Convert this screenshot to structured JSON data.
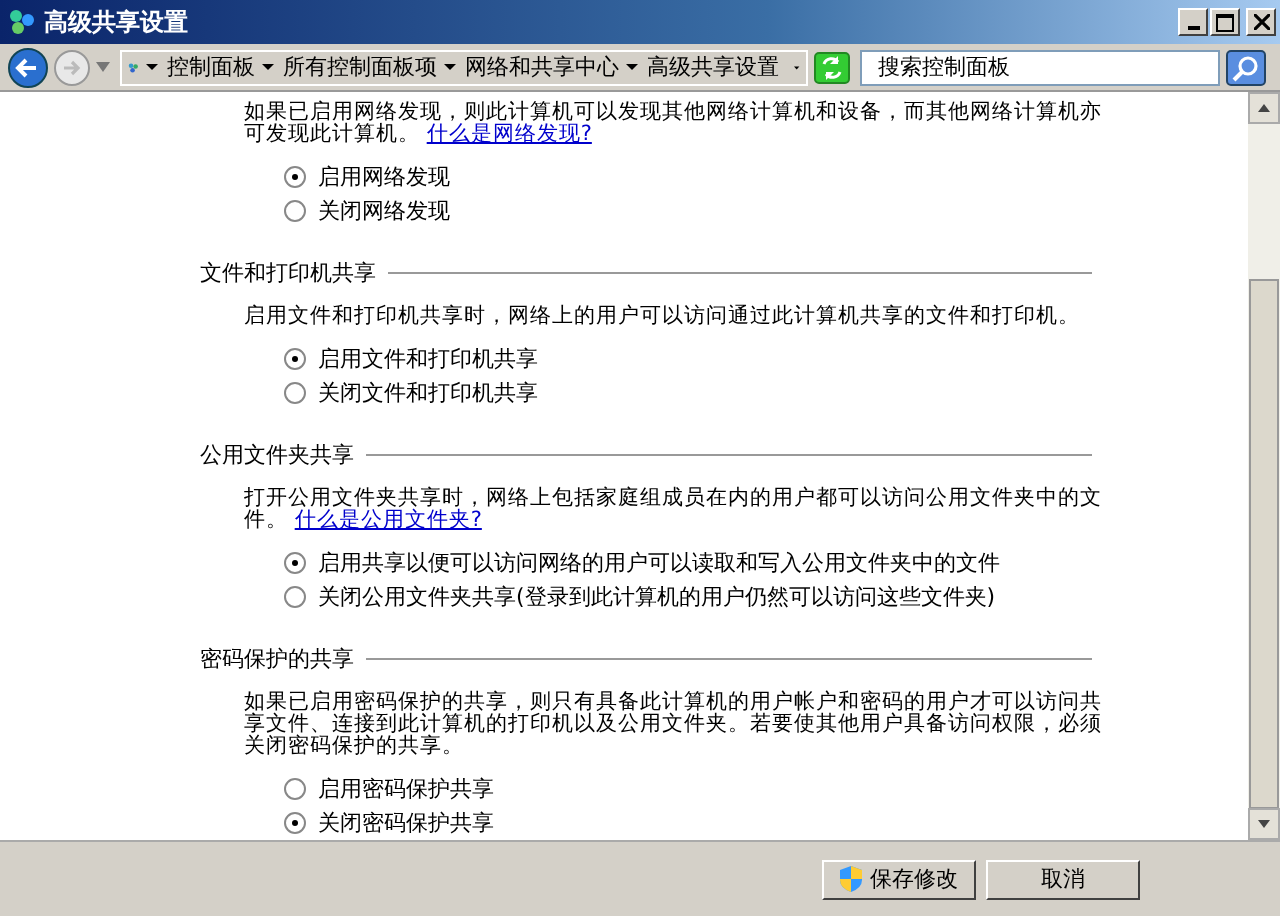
{
  "window": {
    "title": "高级共享设置"
  },
  "address_bar": {
    "breadcrumbs": [
      "控制面板",
      "所有控制面板项",
      "网络和共享中心",
      "高级共享设置"
    ]
  },
  "search": {
    "placeholder": "搜索控制面板"
  },
  "sections": [
    {
      "description": "如果已启用网络发现，则此计算机可以发现其他网络计算机和设备，而其他网络计算机亦可发现此计算机。",
      "link": "什么是网络发现?",
      "options": [
        {
          "label": "启用网络发现",
          "selected": true
        },
        {
          "label": "关闭网络发现",
          "selected": false
        }
      ]
    },
    {
      "heading": "文件和打印机共享",
      "description": "启用文件和打印机共享时，网络上的用户可以访问通过此计算机共享的文件和打印机。",
      "options": [
        {
          "label": "启用文件和打印机共享",
          "selected": true
        },
        {
          "label": "关闭文件和打印机共享",
          "selected": false
        }
      ]
    },
    {
      "heading": "公用文件夹共享",
      "description": "打开公用文件夹共享时，网络上包括家庭组成员在内的用户都可以访问公用文件夹中的文件。",
      "link": "什么是公用文件夹?",
      "options": [
        {
          "label": "启用共享以便可以访问网络的用户可以读取和写入公用文件夹中的文件",
          "selected": true
        },
        {
          "label": "关闭公用文件夹共享(登录到此计算机的用户仍然可以访问这些文件夹)",
          "selected": false
        }
      ]
    },
    {
      "heading": "密码保护的共享",
      "description": "如果已启用密码保护的共享，则只有具备此计算机的用户帐户和密码的用户才可以访问共享文件、连接到此计算机的打印机以及公用文件夹。若要使其他用户具备访问权限，必须关闭密码保护的共享。",
      "options": [
        {
          "label": "启用密码保护共享",
          "selected": false
        },
        {
          "label": "关闭密码保护共享",
          "selected": true
        }
      ]
    }
  ],
  "buttons": [
    {
      "label": "保存修改",
      "kind": "shield"
    },
    {
      "label": "取消",
      "kind": "plain"
    }
  ]
}
